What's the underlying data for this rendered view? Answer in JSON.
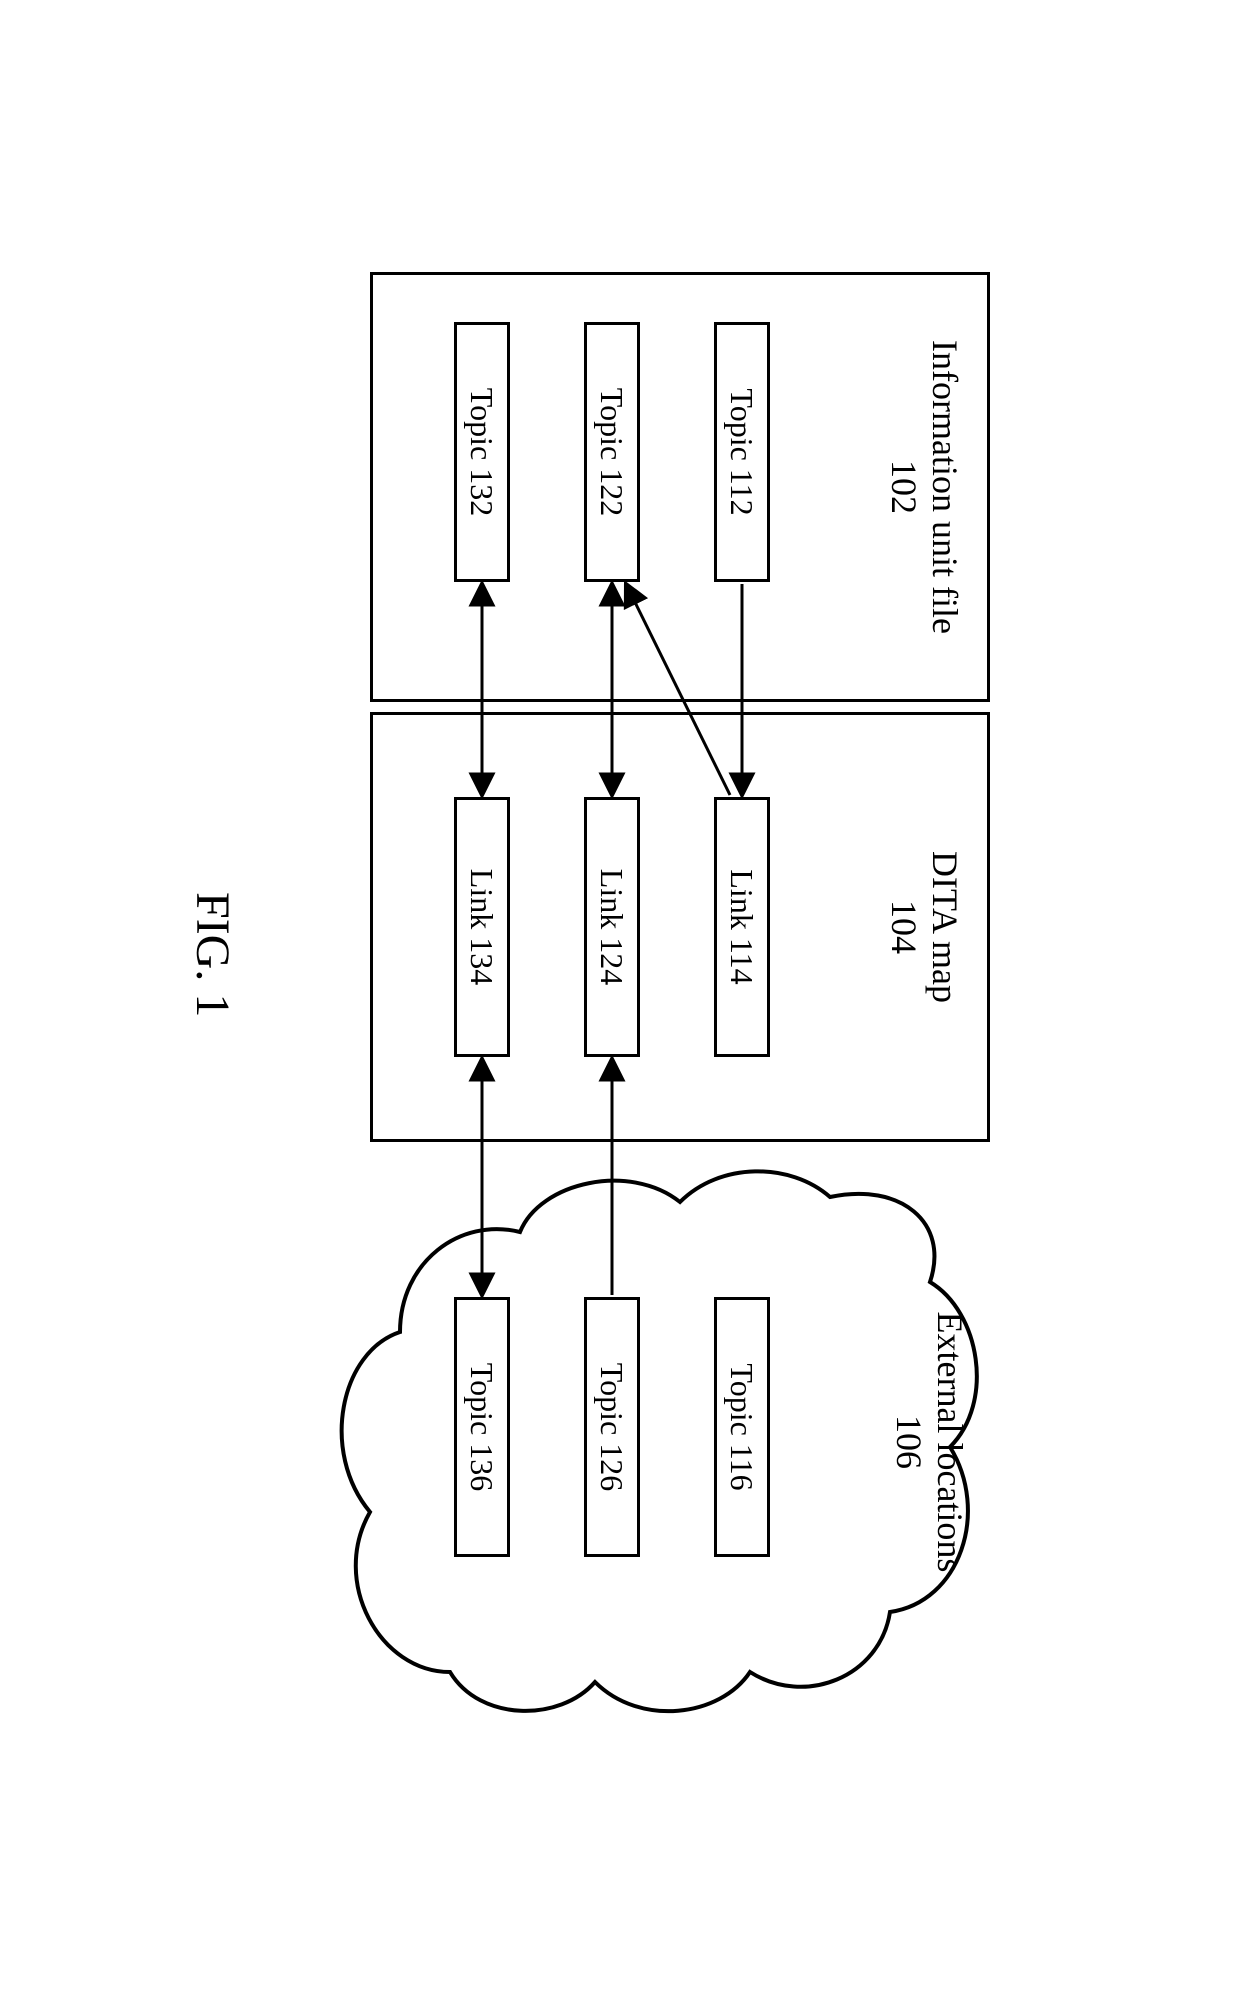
{
  "figure_label": "FIG. 1",
  "containers": {
    "info_unit": {
      "title": "Information unit file",
      "ref": "102"
    },
    "dita_map": {
      "title": "DITA map",
      "ref": "104"
    },
    "external": {
      "title": "External locations",
      "ref": "106"
    }
  },
  "info_unit": {
    "t112": "Topic 112",
    "t122": "Topic 122",
    "t132": "Topic 132"
  },
  "dita_map": {
    "l114": "Link 114",
    "l124": "Link 124",
    "l134": "Link 134"
  },
  "external": {
    "t116": "Topic 116",
    "t126": "Topic 126",
    "t136": "Topic 136"
  }
}
